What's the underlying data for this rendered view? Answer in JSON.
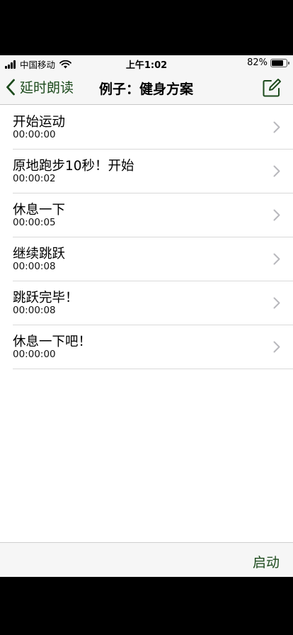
{
  "status_bar": {
    "carrier": "中国移动",
    "time": "上午1:02",
    "battery": "82%",
    "battery_level": 0.82
  },
  "nav": {
    "back_label": "延时朗读",
    "title": "例子：健身方案",
    "compose_icon": "compose-icon"
  },
  "items": [
    {
      "title": "开始运动",
      "time": "00:00:00"
    },
    {
      "title": "原地跑步10秒！开始",
      "time": "00:00:02"
    },
    {
      "title": "休息一下",
      "time": "00:00:05"
    },
    {
      "title": "继续跳跃",
      "time": "00:00:08"
    },
    {
      "title": "跳跃完毕！",
      "time": "00:00:08"
    },
    {
      "title": "休息一下吧！",
      "time": "00:00:00"
    }
  ],
  "toolbar": {
    "start_label": "启动"
  },
  "colors": {
    "accent": "#1c4a1c",
    "bar_bg": "#f6f6f6",
    "separator": "#d9d9d9"
  }
}
